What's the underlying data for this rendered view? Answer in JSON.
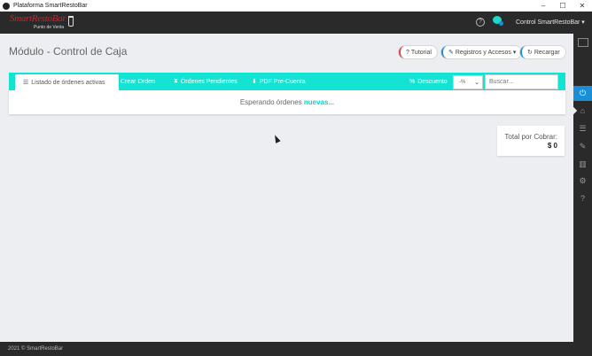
{
  "window": {
    "title": "Plataforma SmartRestoBar",
    "controls": {
      "minimize": "–",
      "maximize": "☐",
      "close": "✕"
    }
  },
  "header": {
    "logo_brand": "SmartRestoBar",
    "logo_sub": "Punto de Venta",
    "help_icon": "?",
    "user_menu": "Control SmartRestoBar ▾"
  },
  "page": {
    "title": "Módulo - Control de Caja",
    "buttons": {
      "tutorial": "Tutorial",
      "registros": "Registros y Accesos ▾",
      "recargar": "Recargar"
    }
  },
  "tabs": {
    "listado": "Listado de órdenes activas",
    "crear": "Crear Orden",
    "pendientes": "Órdenes Pendientes",
    "pdf": "PDF Pre-Cuenta",
    "descuento": "Descuento"
  },
  "discount_select": {
    "value": "-%"
  },
  "search": {
    "placeholder": "Buscar..."
  },
  "orders": {
    "waiting_text": "Esperando órdenes",
    "waiting_emphasis": "nuevas..."
  },
  "total": {
    "label": "Total por Cobrar:",
    "value": "$ 0"
  },
  "footer": {
    "text": "2021 © SmartRestoBar"
  },
  "colors": {
    "accent": "#13e3d2",
    "sidebar_active": "#1a8fd6",
    "dark_bar": "#2a2a2a",
    "logo_red": "#c8242f"
  },
  "icons": {
    "tutorial": "question-circle-icon",
    "registros": "edit-icon",
    "recargar": "refresh-icon",
    "listado": "list-icon",
    "pendientes": "hourglass-icon",
    "pdf": "download-icon",
    "descuento": "percent-icon"
  }
}
